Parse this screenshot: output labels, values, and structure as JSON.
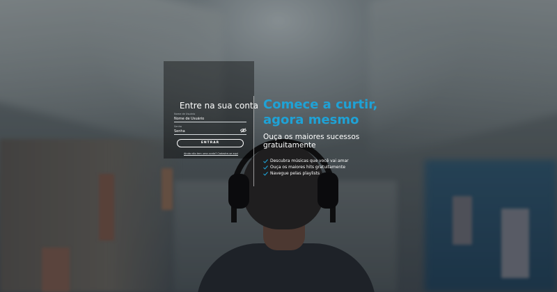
{
  "login": {
    "title": "Entre na sua conta",
    "username_label": "Nome de Usuário",
    "username_placeholder": "Nome de Usuário",
    "password_label": "Senha",
    "password_placeholder": "Senha",
    "submit_label": "ENTRAR",
    "signup_link": "Ainda não tem uma conta? Cadastre-se aqui"
  },
  "promo": {
    "headline_line1": "Comece a curtir,",
    "headline_line2": "agora mesmo",
    "subtitle_line1": "Ouça os maiores sucessos",
    "subtitle_line2": "gratuitamente",
    "features": [
      "Descubra músicas que você vai amar",
      "Ouça os maiores hits gratuitamente",
      "Navegue pelas playlists"
    ]
  },
  "colors": {
    "accent": "#1fa2d6",
    "text": "#ffffff"
  },
  "icons": {
    "password_toggle": "eye-slash-icon",
    "feature_bullet": "check-icon"
  }
}
